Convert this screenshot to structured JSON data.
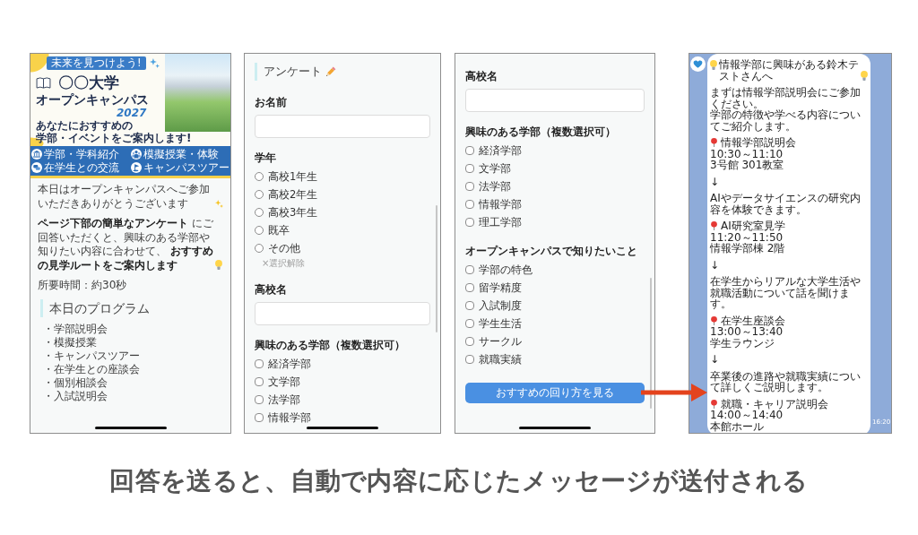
{
  "screens": [
    {
      "kind": "intro",
      "banner": {
        "tagline": "未来を見つけよう!",
        "title": "〇〇大学",
        "subtitle": "オープンキャンパス",
        "year": "2027",
        "lead": [
          "あなたにおすすめの",
          "学部・イベントをご案内します!"
        ],
        "features": [
          "学部・学科紹介",
          "模擬授業・体験",
          "在学生との交流",
          "キャンパスツアー"
        ]
      },
      "paragraphs": [
        "本日はオープンキャンパスへご参加いただきありがとうございます",
        "**ページ下部の簡単なアンケート** にご回答いただくと、興味のある学部や知りたい内容に合わせて、 **おすすめの見学ルートをご案内します**",
        "所要時間：約30秒"
      ],
      "program": {
        "title": "本日のプログラム",
        "items": [
          "・学部説明会",
          "・模擬授業",
          "・キャンパスツアー",
          "・在学生との座談会",
          "・個別相談会",
          "・入試説明会"
        ]
      }
    },
    {
      "kind": "form",
      "title": "アンケート",
      "fields": [
        {
          "kind": "text",
          "label": "お名前"
        },
        {
          "kind": "radio",
          "label": "学年",
          "options": [
            {
              "label": "高校1年生",
              "selected": false
            },
            {
              "label": "高校2年生",
              "selected": false
            },
            {
              "label": "高校3年生",
              "selected": false
            },
            {
              "label": "既卒",
              "selected": false
            },
            {
              "label": "その他",
              "selected": false
            }
          ],
          "clear": "×選択解除"
        },
        {
          "kind": "text",
          "label": "高校名"
        },
        {
          "kind": "checkbox",
          "label": "興味のある学部（複数選択可）",
          "options": [
            {
              "label": "経済学部",
              "checked": false
            },
            {
              "label": "文学部",
              "checked": false
            },
            {
              "label": "法学部",
              "checked": false
            },
            {
              "label": "情報学部",
              "checked": false
            }
          ]
        }
      ]
    },
    {
      "kind": "form",
      "fields": [
        {
          "kind": "text",
          "label": "高校名"
        },
        {
          "kind": "checkbox",
          "label": "興味のある学部（複数選択可）",
          "options": [
            {
              "label": "経済学部",
              "checked": false
            },
            {
              "label": "文学部",
              "checked": false
            },
            {
              "label": "法学部",
              "checked": false
            },
            {
              "label": "情報学部",
              "checked": false
            },
            {
              "label": "理工学部",
              "checked": false
            }
          ]
        },
        {
          "kind": "checkbox",
          "label": "オープンキャンパスで知りたいこと",
          "options": [
            {
              "label": "学部の特色",
              "checked": false
            },
            {
              "label": "留学精度",
              "checked": false
            },
            {
              "label": "入試制度",
              "checked": false
            },
            {
              "label": "学生生活",
              "checked": false
            },
            {
              "label": "サークル",
              "checked": false
            },
            {
              "label": "就職実績",
              "checked": false
            }
          ]
        },
        {
          "kind": "button",
          "label": "おすすめの回り方を見る"
        }
      ]
    },
    {
      "kind": "chat",
      "message": [
        {
          "kind": "greeting",
          "text": "情報学部に興味がある鈴木テストさんへ"
        },
        {
          "kind": "text",
          "lines": [
            "まずは情報学部説明会にご参加ください。",
            "学部の特徴や学べる内容についてご紹介します。"
          ]
        },
        {
          "kind": "event",
          "title": "情報学部説明会",
          "time": "10:30～11:10",
          "place": "3号館 301教室"
        },
        {
          "kind": "arrow",
          "text": "↓"
        },
        {
          "kind": "text",
          "lines": [
            "AIやデータサイエンスの研究内容を体験できます。"
          ]
        },
        {
          "kind": "event",
          "title": "AI研究室見学",
          "time": "11:20～11:50",
          "place": "情報学部棟 2階"
        },
        {
          "kind": "arrow",
          "text": "↓"
        },
        {
          "kind": "text",
          "lines": [
            "在学生からリアルな大学生活や就職活動について話を聞けます。"
          ]
        },
        {
          "kind": "event",
          "title": "在学生座談会",
          "time": "13:00～13:40",
          "place": "学生ラウンジ"
        },
        {
          "kind": "arrow",
          "text": "↓"
        },
        {
          "kind": "text",
          "lines": [
            "卒業後の進路や就職実績について詳しくご説明します。"
          ]
        },
        {
          "kind": "event",
          "title": "就職・キャリア説明会",
          "time": "14:00～14:40",
          "place": "本館ホール"
        }
      ],
      "time": "16:20"
    }
  ],
  "caption": "回答を送ると、自動で内容に応じたメッセージが送付される"
}
